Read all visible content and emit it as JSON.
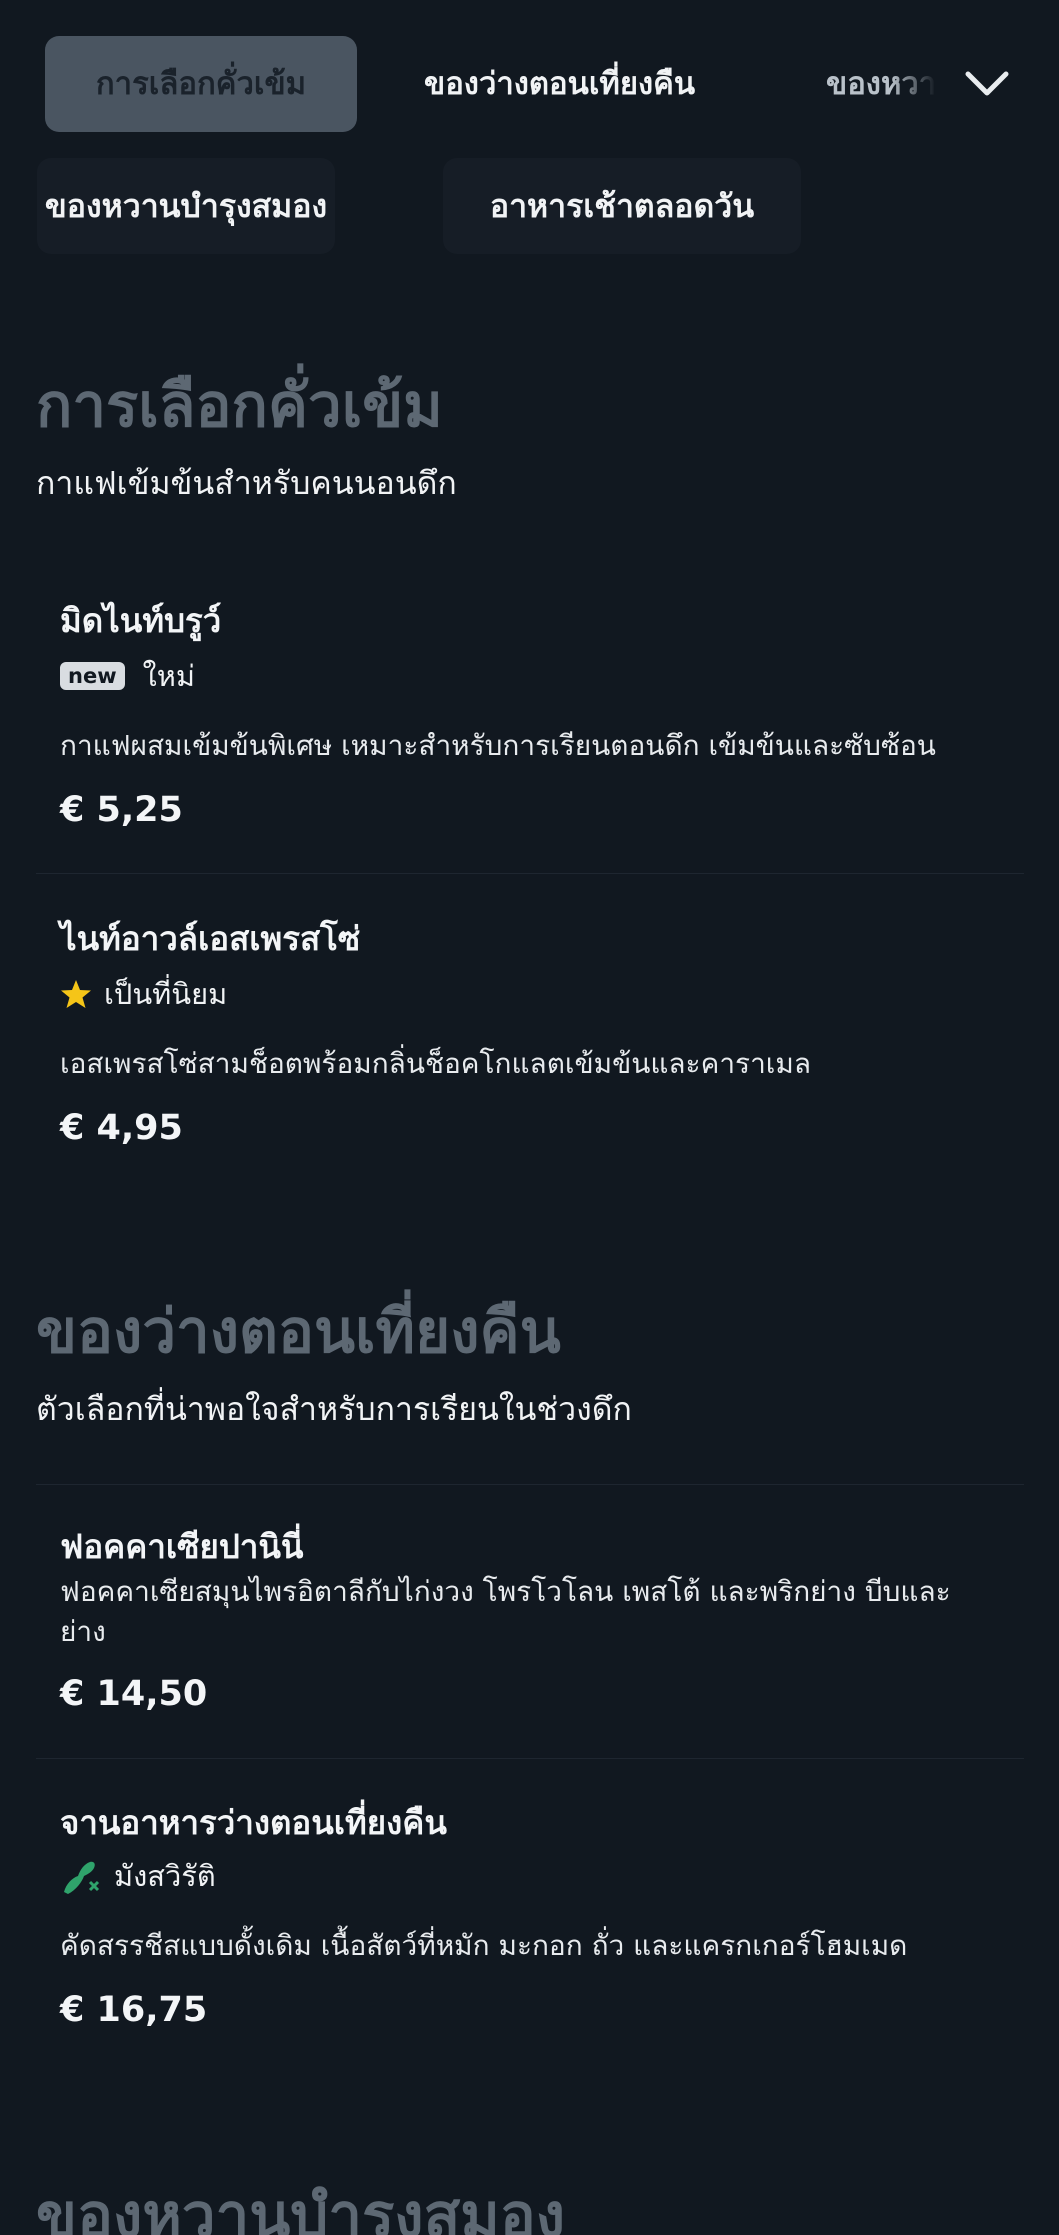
{
  "tabs": [
    {
      "label": "การเลือกคั่วเข้ม"
    },
    {
      "label": "ของว่างตอนเที่ยงคืน"
    },
    {
      "label": "ของหวานบำรุงสมอง"
    }
  ],
  "chips": [
    {
      "label": "ของหวานบำรุงสมอง"
    },
    {
      "label": "อาหารเช้าตลอดวัน"
    }
  ],
  "sections": [
    {
      "title": "การเลือกคั่วเข้ม",
      "subtitle": "กาแฟเข้มข้นสำหรับคนนอนดึก",
      "items": [
        {
          "name": "มิดไนท์บรูว์",
          "badge_tag": "new",
          "badge_text": "ใหม่",
          "description": "กาแฟผสมเข้มข้นพิเศษ เหมาะสำหรับการเรียนตอนดึก เข้มข้นและซับซ้อน",
          "price": "€ 5,25"
        },
        {
          "name": "ไนท์อาวล์เอสเพรสโซ่",
          "badge_icon": "star-icon",
          "badge_text": "เป็นที่นิยม",
          "description": "เอสเพรสโซ่สามช็อตพร้อมกลิ่นช็อคโกแลตเข้มข้นและคาราเมล",
          "price": "€ 4,95"
        }
      ]
    },
    {
      "title": "ของว่างตอนเที่ยงคืน",
      "subtitle": "ตัวเลือกที่น่าพอใจสำหรับการเรียนในช่วงดึก",
      "items": [
        {
          "name": "ฟอคคาเซียปานินี่",
          "description": "ฟอคคาเซียสมุนไพรอิตาลีกับไก่งวง โพรโวโลน เพสโต้ และพริกย่าง บีบและย่าง",
          "price": "€ 14,50"
        },
        {
          "name": "จานอาหารว่างตอนเที่ยงคืน",
          "badge_icon": "vegetarian-icon",
          "badge_text": "มังสวิรัติ",
          "description": "คัดสรรชีสแบบดั้งเดิม เนื้อสัตว์ที่หมัก มะกอก ถั่ว และแครกเกอร์โฮมเมด",
          "price": "€ 16,75"
        }
      ]
    },
    {
      "title": "ของหวานบำรุงสมอง"
    }
  ],
  "colors": {
    "background": "#111820",
    "active_tab": "#4a5561",
    "star": "#f5c518",
    "veg": "#2fa36b"
  }
}
